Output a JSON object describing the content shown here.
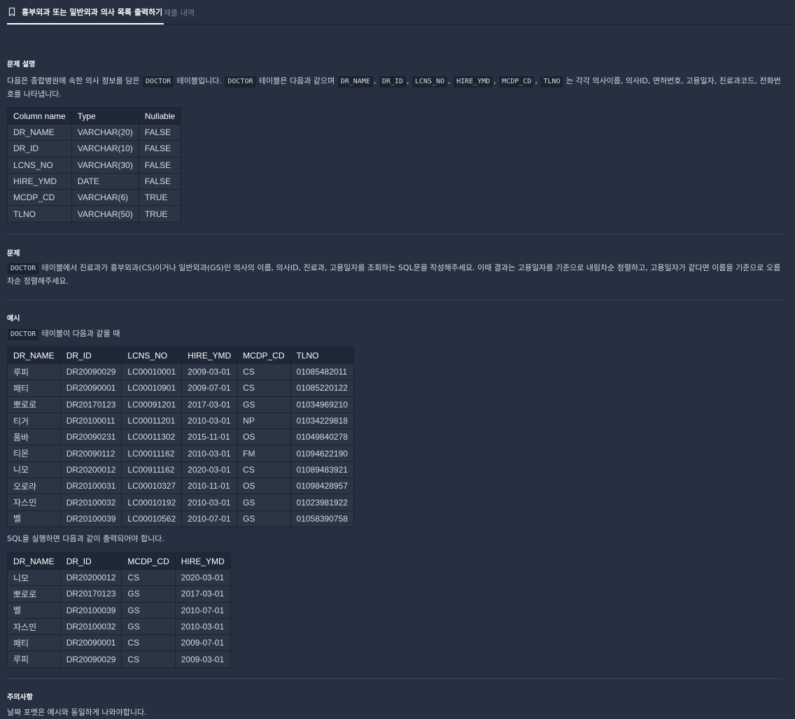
{
  "tabs": {
    "problem": "흉부외과 또는 일반외과 의사 목록 출력하기",
    "submissions": "제출 내역"
  },
  "description": {
    "title": "문제 설명",
    "text_before": "다음은 종합병원에 속한 의사 정보를 담은",
    "code1": "DOCTOR",
    "text_mid": "테이블입니다.",
    "code2": "DOCTOR",
    "text_mid2": "테이블은 다음과 같으며",
    "cols": [
      "DR_NAME",
      "DR_ID",
      "LCNS_NO",
      "HIRE_YMD",
      "MCDP_CD",
      "TLNO"
    ],
    "sep": ",",
    "text_after": "는 각각 의사이름, 의사ID, 면허번호, 고용일자, 진료과코드, 전화번호를 나타냅니다."
  },
  "schema_table": {
    "headers": [
      "Column name",
      "Type",
      "Nullable"
    ],
    "rows": [
      [
        "DR_NAME",
        "VARCHAR(20)",
        "FALSE"
      ],
      [
        "DR_ID",
        "VARCHAR(10)",
        "FALSE"
      ],
      [
        "LCNS_NO",
        "VARCHAR(30)",
        "FALSE"
      ],
      [
        "HIRE_YMD",
        "DATE",
        "FALSE"
      ],
      [
        "MCDP_CD",
        "VARCHAR(6)",
        "TRUE"
      ],
      [
        "TLNO",
        "VARCHAR(50)",
        "TRUE"
      ]
    ]
  },
  "question": {
    "title": "문제",
    "code": "DOCTOR",
    "text": "테이블에서 진료과가 흉부외과(CS)이거나 일반외과(GS)인 의사의 이름, 의사ID, 진료과, 고용일자를 조회하는 SQL문을 작성해주세요. 이때 결과는 고용일자를 기준으로 내림차순 정렬하고, 고용일자가 같다면 이름을 기준으로 오름차순 정렬해주세요."
  },
  "example": {
    "title": "예시",
    "code": "DOCTOR",
    "intro": "테이블이 다음과 같을 때",
    "table": {
      "headers": [
        "DR_NAME",
        "DR_ID",
        "LCNS_NO",
        "HIRE_YMD",
        "MCDP_CD",
        "TLNO"
      ],
      "rows": [
        [
          "루피",
          "DR20090029",
          "LC00010001",
          "2009-03-01",
          "CS",
          "01085482011"
        ],
        [
          "패티",
          "DR20090001",
          "LC00010901",
          "2009-07-01",
          "CS",
          "01085220122"
        ],
        [
          "뽀로로",
          "DR20170123",
          "LC00091201",
          "2017-03-01",
          "GS",
          "01034969210"
        ],
        [
          "티거",
          "DR20100011",
          "LC00011201",
          "2010-03-01",
          "NP",
          "01034229818"
        ],
        [
          "품바",
          "DR20090231",
          "LC00011302",
          "2015-11-01",
          "OS",
          "01049840278"
        ],
        [
          "티몬",
          "DR20090112",
          "LC00011162",
          "2010-03-01",
          "FM",
          "01094622190"
        ],
        [
          "니모",
          "DR20200012",
          "LC00911162",
          "2020-03-01",
          "CS",
          "01089483921"
        ],
        [
          "오로라",
          "DR20100031",
          "LC00010327",
          "2010-11-01",
          "OS",
          "01098428957"
        ],
        [
          "자스민",
          "DR20100032",
          "LC00010192",
          "2010-03-01",
          "GS",
          "01023981922"
        ],
        [
          "벨",
          "DR20100039",
          "LC00010562",
          "2010-07-01",
          "GS",
          "01058390758"
        ]
      ]
    },
    "result_intro": "SQL을 실행하면 다음과 같이 출력되어야 합니다.",
    "result_table": {
      "headers": [
        "DR_NAME",
        "DR_ID",
        "MCDP_CD",
        "HIRE_YMD"
      ],
      "rows": [
        [
          "니모",
          "DR20200012",
          "CS",
          "2020-03-01"
        ],
        [
          "뽀로로",
          "DR20170123",
          "GS",
          "2017-03-01"
        ],
        [
          "벨",
          "DR20100039",
          "GS",
          "2010-07-01"
        ],
        [
          "자스민",
          "DR20100032",
          "GS",
          "2010-03-01"
        ],
        [
          "패티",
          "DR20090001",
          "CS",
          "2009-07-01"
        ],
        [
          "루피",
          "DR20090029",
          "CS",
          "2009-03-01"
        ]
      ]
    }
  },
  "notes": {
    "title": "주의사항",
    "text": "날짜 포멧은 예시와 동일하게 나와야합니다."
  }
}
